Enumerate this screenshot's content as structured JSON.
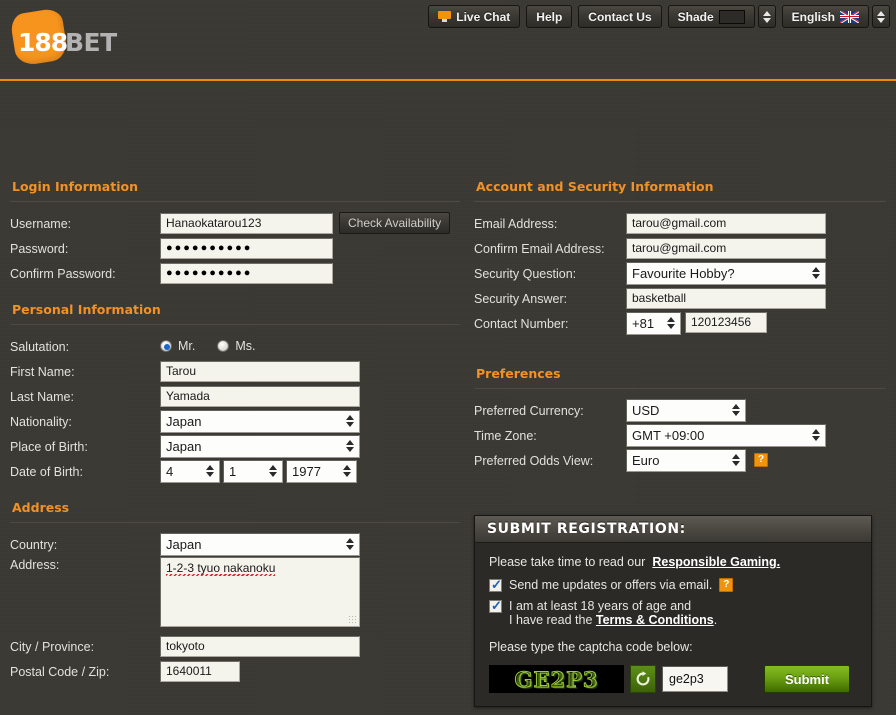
{
  "brand": {
    "logo_primary": "188",
    "logo_secondary": "BET",
    "accent": "#f7941e"
  },
  "topnav": {
    "live_chat": "Live Chat",
    "help": "Help",
    "contact_us": "Contact Us",
    "shade": "Shade",
    "language": "English"
  },
  "login_information": {
    "title": "Login Information",
    "username_label": "Username:",
    "username_value": "Hanaokatarou123",
    "check_availability": "Check Availability",
    "password_label": "Password:",
    "password_value": "●●●●●●●●●●",
    "confirm_password_label": "Confirm Password:",
    "confirm_password_value": "●●●●●●●●●●"
  },
  "personal_information": {
    "title": "Personal Information",
    "salutation_label": "Salutation:",
    "salutation_mr": "Mr.",
    "salutation_ms": "Ms.",
    "salutation_selected": "Mr.",
    "first_name_label": "First Name:",
    "first_name_value": "Tarou",
    "last_name_label": "Last Name:",
    "last_name_value": "Yamada",
    "nationality_label": "Nationality:",
    "nationality_value": "Japan",
    "place_of_birth_label": "Place of Birth:",
    "place_of_birth_value": "Japan",
    "date_of_birth_label": "Date of Birth:",
    "dob_day": "4",
    "dob_month": "1",
    "dob_year": "1977"
  },
  "address": {
    "title": "Address",
    "country_label": "Country:",
    "country_value": "Japan",
    "address_label": "Address:",
    "address_value": "1-2-3 tyuo nakanoku",
    "city_label": "City / Province:",
    "city_value": "tokyoto",
    "postal_label": "Postal Code / Zip:",
    "postal_value": "1640011"
  },
  "account_security": {
    "title": "Account and Security Information",
    "email_label": "Email Address:",
    "email_value": "tarou@gmail.com",
    "confirm_email_label": "Confirm Email Address:",
    "confirm_email_value": "tarou@gmail.com",
    "security_question_label": "Security Question:",
    "security_question_value": "Favourite Hobby?",
    "security_answer_label": "Security Answer:",
    "security_answer_value": "basketball",
    "contact_number_label": "Contact Number:",
    "contact_code": "+81",
    "contact_number": "120123456"
  },
  "preferences": {
    "title": "Preferences",
    "currency_label": "Preferred Currency:",
    "currency_value": "USD",
    "timezone_label": "Time Zone:",
    "timezone_value": "GMT +09:00",
    "odds_label": "Preferred Odds View:",
    "odds_value": "Euro",
    "odds_help": "?"
  },
  "submit_panel": {
    "title": "SUBMIT REGISTRATION:",
    "read_prefix": "Please take time to read our",
    "responsible_gaming": "Responsible Gaming.",
    "updates_label": "Send me updates or offers via email.",
    "updates_checked": true,
    "updates_help": "?",
    "age_line1": "I am at least 18 years of age and",
    "age_line2_prefix": "I have read the",
    "terms": "Terms & Conditions",
    "age_line2_suffix": ".",
    "age_checked": true,
    "captcha_prompt": "Please type the captcha code below:",
    "captcha_image_text": "GE2P3",
    "captcha_input_value": "ge2p3",
    "submit_label": "Submit",
    "submit_color": "#6aa012"
  }
}
